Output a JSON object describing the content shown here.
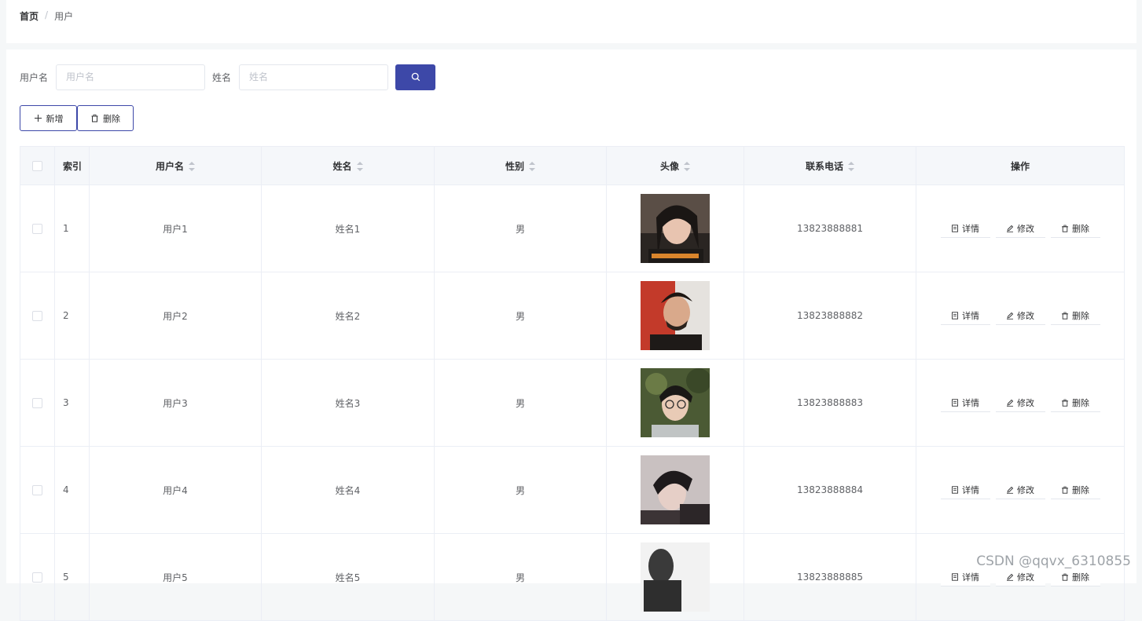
{
  "breadcrumb": {
    "home": "首页",
    "separator": "/",
    "current": "用户"
  },
  "search": {
    "username_label": "用户名",
    "username_placeholder": "用户名",
    "name_label": "姓名",
    "name_placeholder": "姓名",
    "button_icon": "search-icon"
  },
  "actions": {
    "add_label": "新增",
    "delete_label": "删除"
  },
  "table": {
    "columns": {
      "index": "索引",
      "username": "用户名",
      "name": "姓名",
      "gender": "性别",
      "avatar": "头像",
      "phone": "联系电话",
      "operations": "操作"
    },
    "op_labels": {
      "detail": "详情",
      "edit": "修改",
      "delete": "删除"
    },
    "rows": [
      {
        "index": "1",
        "username": "用户1",
        "name": "姓名1",
        "gender": "男",
        "phone": "13823888881"
      },
      {
        "index": "2",
        "username": "用户2",
        "name": "姓名2",
        "gender": "男",
        "phone": "13823888882"
      },
      {
        "index": "3",
        "username": "用户3",
        "name": "姓名3",
        "gender": "男",
        "phone": "13823888883"
      },
      {
        "index": "4",
        "username": "用户4",
        "name": "姓名4",
        "gender": "男",
        "phone": "13823888884"
      },
      {
        "index": "5",
        "username": "用户5",
        "name": "姓名5",
        "gender": "男",
        "phone": "13823888885"
      }
    ]
  },
  "watermark": "CSDN @qqvx_6310855",
  "colors": {
    "primary": "#3d48a8",
    "header_bg": "#f5f7fa",
    "border": "#ebeef5"
  }
}
